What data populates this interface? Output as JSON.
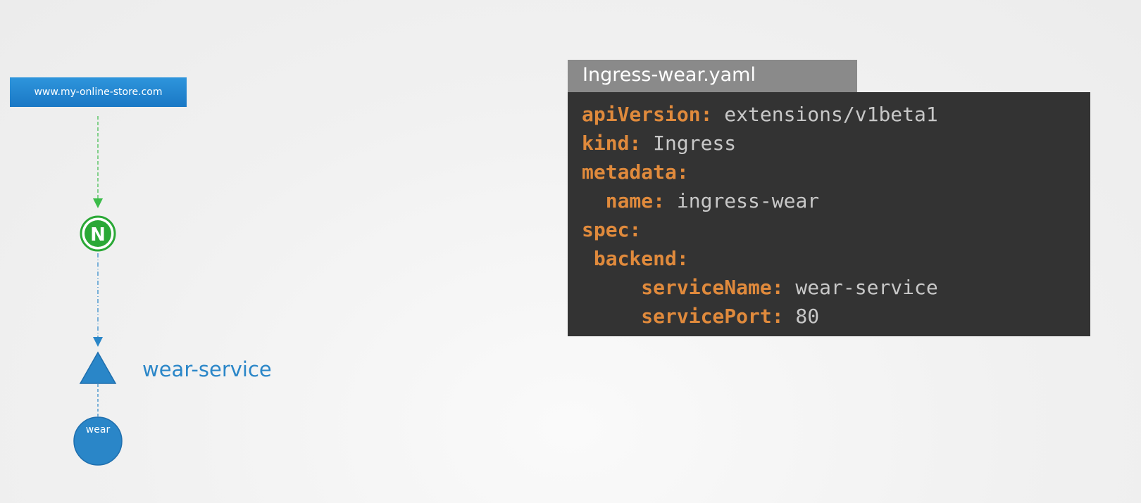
{
  "diagram": {
    "host_label": "www.my-online-store.com",
    "controller_icon": "nginx-icon",
    "controller_letter": "N",
    "service_label": "wear-service",
    "pod_label": "wear",
    "colors": {
      "host_box": "#1f80cc",
      "controller_arrow": "#3cbc4a",
      "controller_fill": "#2aa836",
      "service_blue": "#2a86c8",
      "pod_fill": "#2a86c8"
    }
  },
  "yaml_file": {
    "filename": "Ingress-wear.yaml",
    "lines": [
      {
        "key": "apiVersion:",
        "value": " extensions/v1beta1"
      },
      {
        "key": "kind:",
        "value": " Ingress"
      },
      {
        "key": "metadata:",
        "value": ""
      },
      {
        "key": "  name:",
        "value": " ingress-wear"
      },
      {
        "key": "spec:",
        "value": ""
      },
      {
        "key": " backend:",
        "value": ""
      },
      {
        "key": "     serviceName:",
        "value": " wear-service"
      },
      {
        "key": "     servicePort:",
        "value": " 80"
      }
    ],
    "colors": {
      "key": "#e08a3c",
      "value": "#c8c8c8",
      "background": "#333333",
      "tab": "#8a8a8a"
    }
  }
}
